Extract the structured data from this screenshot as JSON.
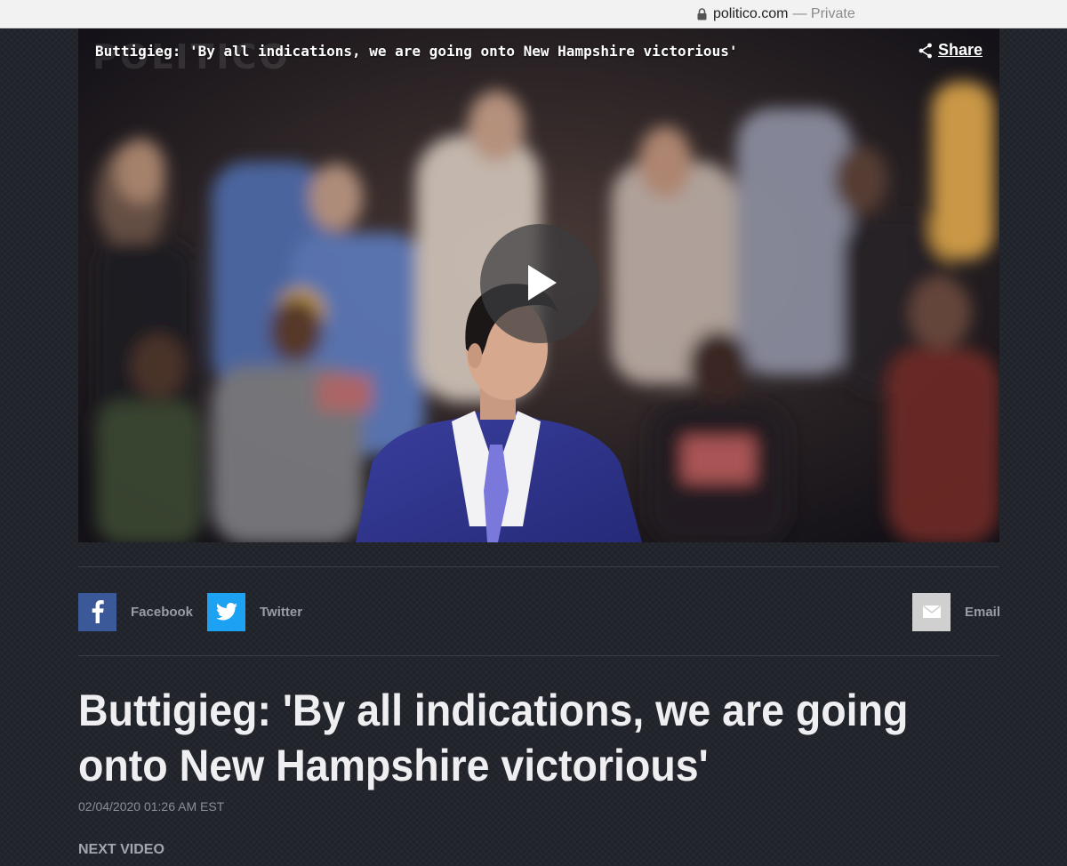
{
  "browser": {
    "domain": "politico.com",
    "mode": "— Private"
  },
  "video": {
    "title": "Buttigieg: 'By all indications, we are going onto New Hampshire victorious'",
    "watermark": "POLITICO",
    "share_label": "Share",
    "play_icon": "play-icon"
  },
  "share_bar": {
    "facebook": {
      "label": "Facebook",
      "icon": "facebook-icon",
      "color": "#3b5998"
    },
    "twitter": {
      "label": "Twitter",
      "icon": "twitter-icon",
      "color": "#1da1f2"
    },
    "email": {
      "label": "Email",
      "icon": "email-icon",
      "color": "#d0d0d0"
    }
  },
  "article": {
    "headline": "Buttigieg: 'By all indications, we are going onto New Hampshire victorious'",
    "timestamp": "02/04/2020 01:26 AM EST",
    "next_video_label": "NEXT VIDEO"
  }
}
